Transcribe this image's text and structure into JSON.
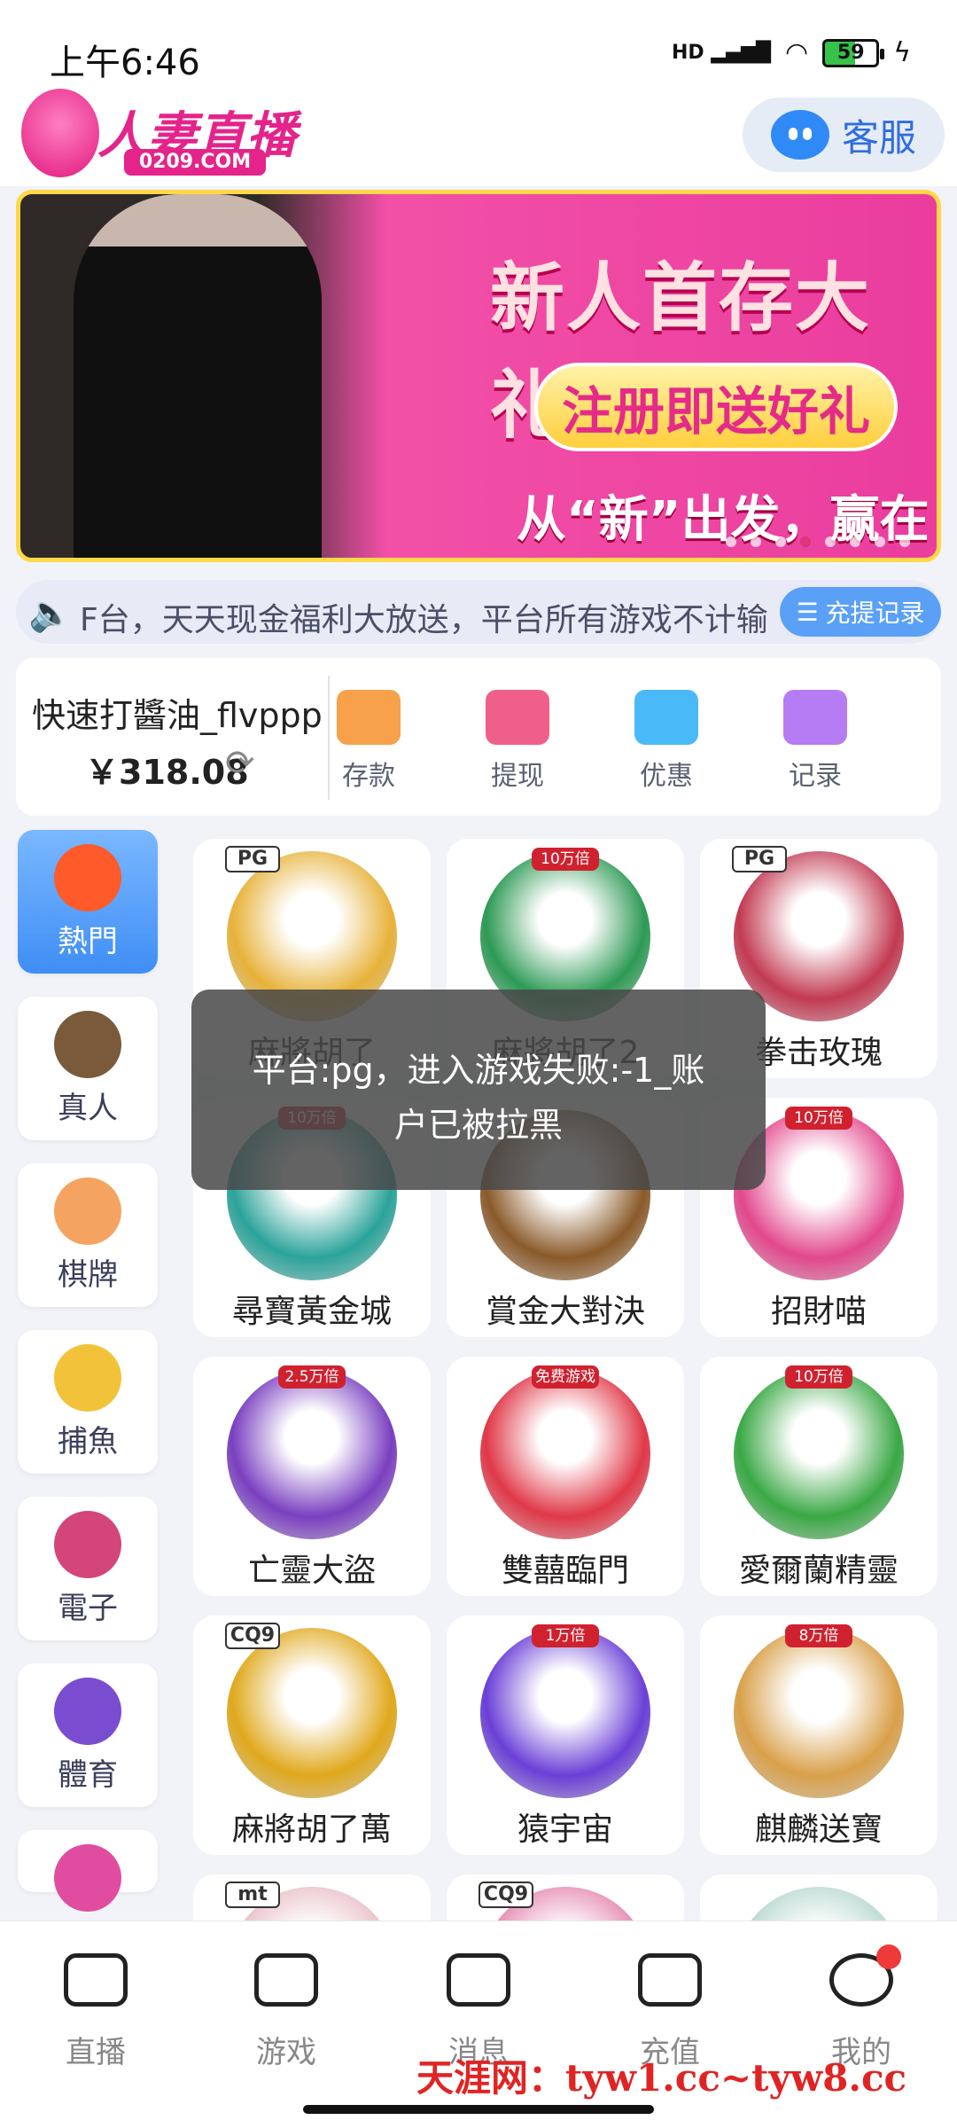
{
  "status": {
    "time": "上午6:46",
    "net": "HD",
    "battery": "59"
  },
  "header": {
    "logo_text": "人妻直播",
    "logo_sub": "0209.COM",
    "customer_service": "客服"
  },
  "banner": {
    "title": "新人首存大礼包",
    "pill": "注册即送好礼",
    "subtitle": "从“新”出发，赢在起点!",
    "dots": 8,
    "active_dot": 3
  },
  "notice": {
    "text": "F台，天天现金福利大放送，平台所有游戏不计输",
    "record_button": "充提记录"
  },
  "account": {
    "username": "快速打醬油_flvppp",
    "balance": "￥318.08",
    "actions": [
      {
        "label": "存款",
        "icon": "wallet-icon",
        "color": "#f7a24a"
      },
      {
        "label": "提现",
        "icon": "withdraw-icon",
        "color": "#f05f8a"
      },
      {
        "label": "优惠",
        "icon": "gift-icon",
        "color": "#4ab9f7"
      },
      {
        "label": "记录",
        "icon": "folder-clock-icon",
        "color": "#b57cf4"
      }
    ]
  },
  "categories": [
    {
      "label": "熱門",
      "icon": "fire-icon",
      "color": "#ff5a2a",
      "active": true
    },
    {
      "label": "真人",
      "icon": "chip-icon",
      "color": "#7a5a3a",
      "active": false
    },
    {
      "label": "棋牌",
      "icon": "cards-icon",
      "color": "#f4a460",
      "active": false
    },
    {
      "label": "捕魚",
      "icon": "shark-icon",
      "color": "#f2c33a",
      "active": false
    },
    {
      "label": "電子",
      "icon": "slot-machine-icon",
      "color": "#d4457a",
      "active": false
    },
    {
      "label": "體育",
      "icon": "soccer-ball-icon",
      "color": "#7a4cd0",
      "active": false
    },
    {
      "label": "",
      "icon": "lottery-ball-icon",
      "color": "#e04da0",
      "active": false
    }
  ],
  "games": [
    {
      "name": "麻將胡了",
      "badge": "",
      "provider": "PG",
      "color": "#e7b23a"
    },
    {
      "name": "麻將胡了2",
      "badge": "10万倍",
      "provider": "",
      "color": "#2d9a55"
    },
    {
      "name": "拳击玫瑰",
      "badge": "",
      "provider": "PG",
      "color": "#c23a52"
    },
    {
      "name": "尋寶黃金城",
      "badge": "10万倍",
      "provider": "",
      "color": "#2aa39a"
    },
    {
      "name": "賞金大對決",
      "badge": "",
      "provider": "",
      "color": "#8a5a2a"
    },
    {
      "name": "招財喵",
      "badge": "10万倍",
      "provider": "",
      "color": "#e2478c"
    },
    {
      "name": "亡靈大盜",
      "badge": "2.5万倍",
      "provider": "",
      "color": "#7a3fc0"
    },
    {
      "name": "雙囍臨門",
      "badge": "免费游戏",
      "provider": "",
      "color": "#e03848"
    },
    {
      "name": "愛爾蘭精靈",
      "badge": "10万倍",
      "provider": "",
      "color": "#3aa845"
    },
    {
      "name": "麻將胡了萬",
      "badge": "",
      "provider": "CQ9",
      "color": "#e0a81c"
    },
    {
      "name": "猿宇宙",
      "badge": "1万倍",
      "provider": "",
      "color": "#6a3fd6"
    },
    {
      "name": "麒麟送寶",
      "badge": "8万倍",
      "provider": "",
      "color": "#d9a04a"
    },
    {
      "name": "",
      "badge": "",
      "provider": "mt",
      "color": "#e9c0c8"
    },
    {
      "name": "",
      "badge": "",
      "provider": "CQ9",
      "color": "#e488b0"
    },
    {
      "name": "",
      "badge": "",
      "provider": "",
      "color": "#b9d8d0"
    }
  ],
  "toast": {
    "line1": "平台:pg，进入游戏失败:-1_账",
    "line2": "户已被拉黑"
  },
  "tabbar": [
    {
      "label": "直播",
      "icon": "video-camera-icon"
    },
    {
      "label": "游戏",
      "icon": "gamepad-icon"
    },
    {
      "label": "消息",
      "icon": "chat-icon"
    },
    {
      "label": "充值",
      "icon": "wallet-icon"
    },
    {
      "label": "我的",
      "icon": "profile-smile-icon"
    }
  ],
  "watermark": "天涯网：tyw1.cc~tyw8.cc"
}
